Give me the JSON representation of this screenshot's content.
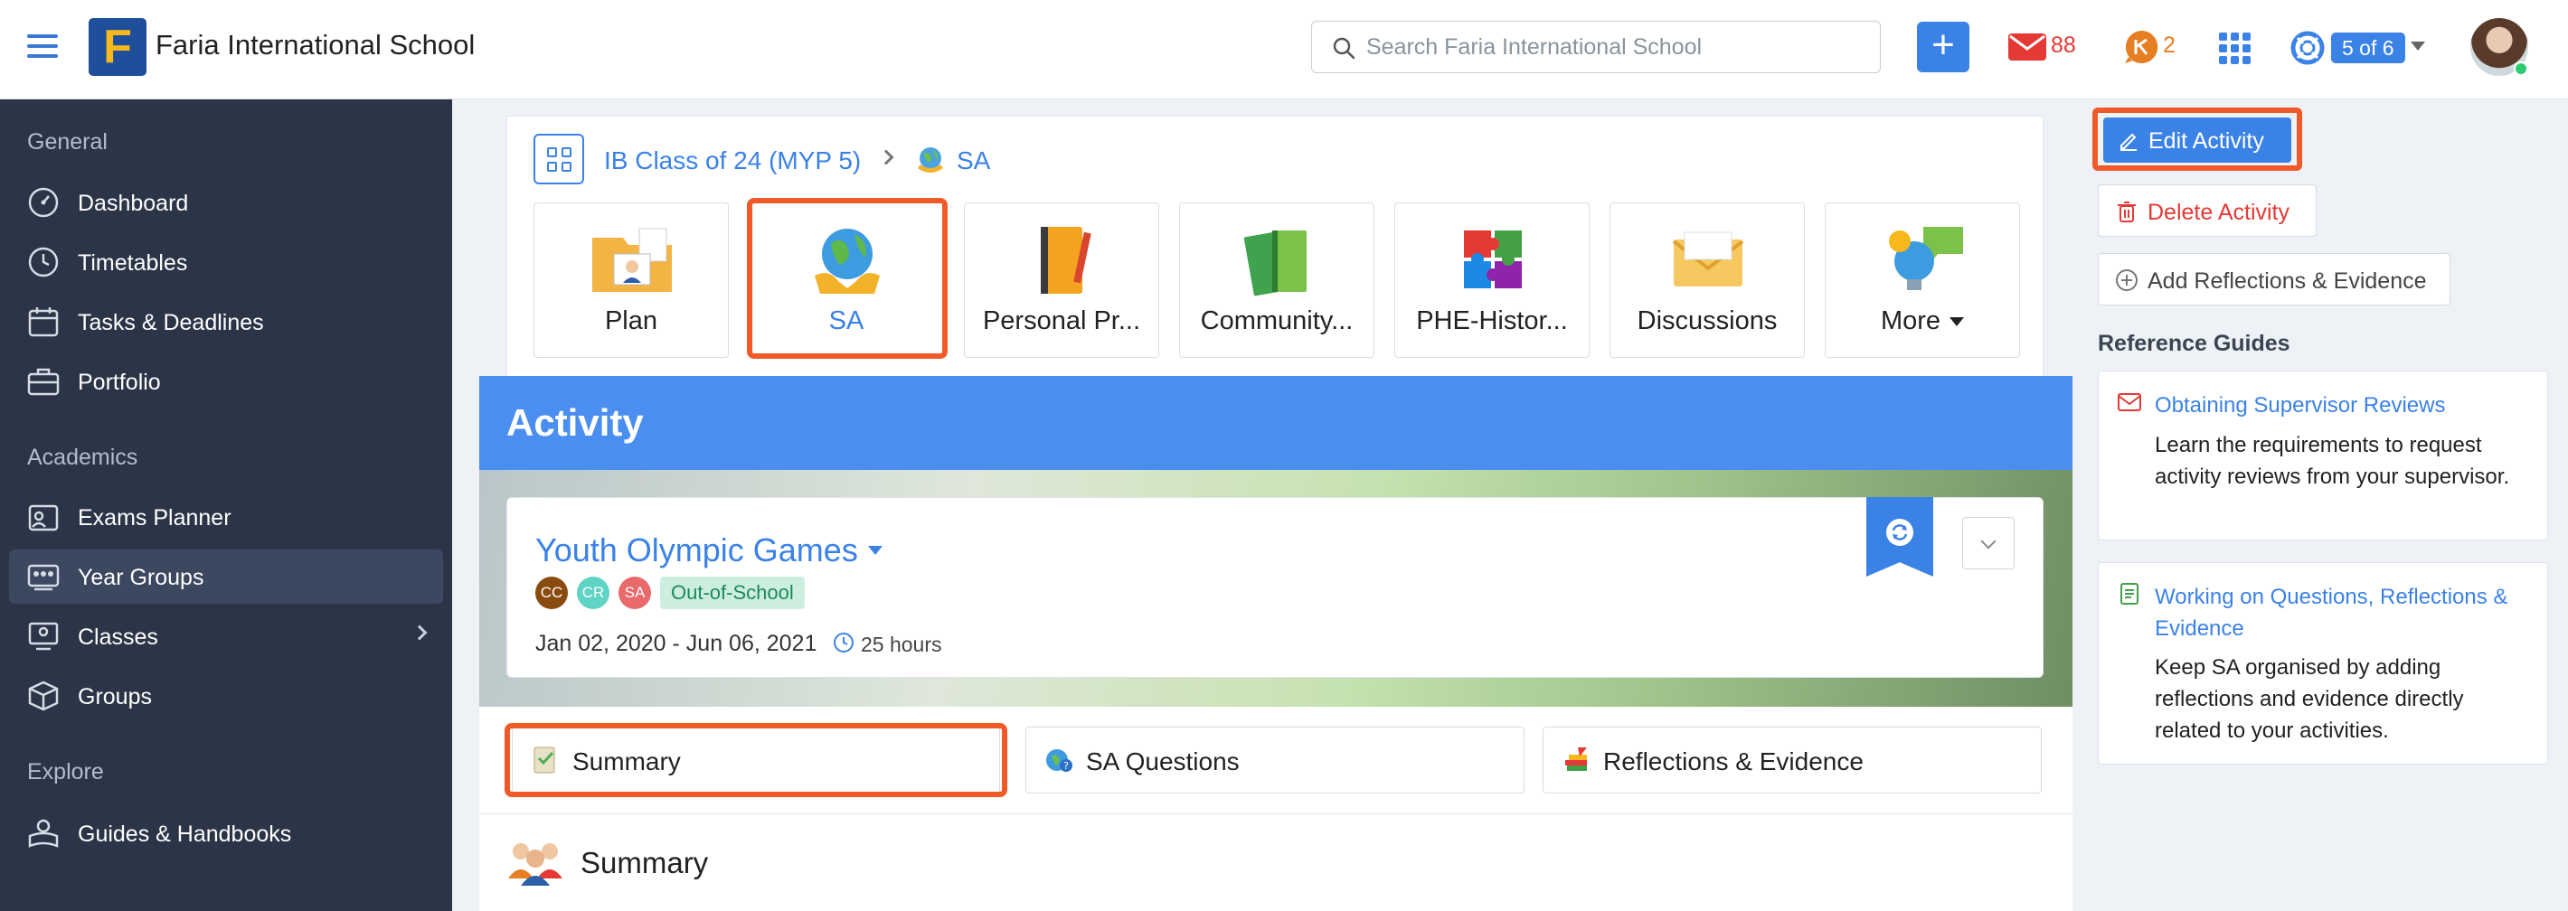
{
  "header": {
    "school_name": "Faria International School",
    "logo_letter": "F",
    "search_placeholder": "Search Faria International School",
    "mail_count": "88",
    "notification_count": "2",
    "pager": "5 of 6"
  },
  "sidebar": {
    "sections": [
      {
        "title": "General",
        "items": [
          {
            "label": "Dashboard",
            "icon": "dashboard-icon"
          },
          {
            "label": "Timetables",
            "icon": "clock-icon"
          },
          {
            "label": "Tasks & Deadlines",
            "icon": "calendar-icon"
          },
          {
            "label": "Portfolio",
            "icon": "briefcase-icon"
          }
        ]
      },
      {
        "title": "Academics",
        "items": [
          {
            "label": "Exams Planner",
            "icon": "exams-icon"
          },
          {
            "label": "Year Groups",
            "icon": "year-groups-icon",
            "active": true
          },
          {
            "label": "Classes",
            "icon": "classes-icon"
          },
          {
            "label": "Groups",
            "icon": "cube-icon"
          }
        ]
      },
      {
        "title": "Explore",
        "items": [
          {
            "label": "Guides & Handbooks",
            "icon": "handbook-icon"
          }
        ]
      }
    ]
  },
  "breadcrumb": {
    "parent": "IB Class of 24 (MYP 5)",
    "current": "SA"
  },
  "tiles": [
    {
      "label": "Plan",
      "icon": "plan-folder-icon"
    },
    {
      "label": "SA",
      "icon": "globe-hands-icon",
      "active": true
    },
    {
      "label": "Personal Pr...",
      "icon": "notebook-icon"
    },
    {
      "label": "Community...",
      "icon": "books-icon"
    },
    {
      "label": "PHE-Histor...",
      "icon": "puzzle-icon"
    },
    {
      "label": "Discussions",
      "icon": "envelope-icon"
    },
    {
      "label": "More",
      "icon": "lightbulb-chat-icon"
    }
  ],
  "activity": {
    "section_title": "Activity",
    "name": "Youth Olympic Games",
    "participants": [
      "CC",
      "CR",
      "SA"
    ],
    "tag": "Out-of-School",
    "dates": "Jan 02, 2020 - Jun 06, 2021",
    "hours": "25 hours"
  },
  "subtabs": [
    {
      "label": "Summary",
      "icon": "summary-icon"
    },
    {
      "label": "SA Questions",
      "icon": "questions-icon"
    },
    {
      "label": "Reflections & Evidence",
      "icon": "reflections-icon"
    }
  ],
  "summary": {
    "title": "Summary"
  },
  "actions": {
    "edit": "Edit Activity",
    "delete": "Delete Activity",
    "add": "Add Reflections & Evidence"
  },
  "reference": {
    "heading": "Reference Guides",
    "guides": [
      {
        "title": "Obtaining Supervisor Reviews",
        "desc": "Learn the requirements to request activity reviews from your supervisor."
      },
      {
        "title": "Working on Questions, Reflections & Evidence",
        "desc": "Keep SA organised by adding reflections and evidence directly related to your activities."
      }
    ]
  },
  "colors": {
    "accent": "#3b82e6",
    "highlight": "#f05a28",
    "sidebar_bg": "#2b3547",
    "danger": "#e53935",
    "tag_bg": "#cdeedf"
  }
}
